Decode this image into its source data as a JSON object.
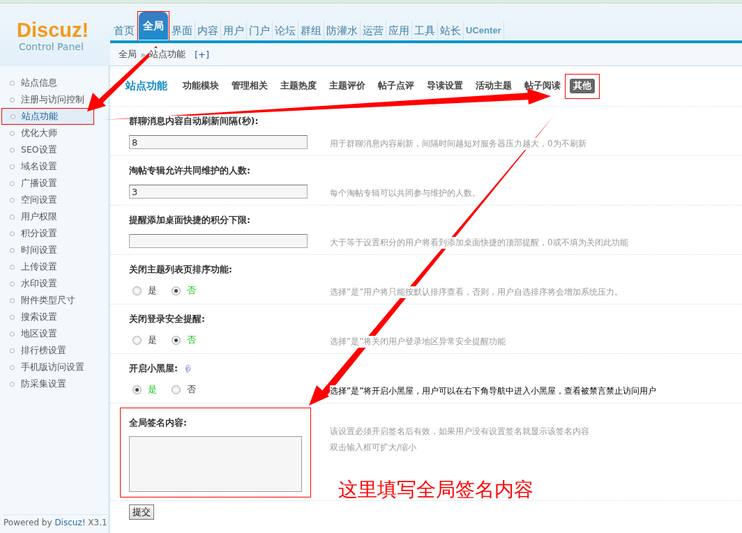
{
  "logo": {
    "name": "Discuz!",
    "subtitle": "Control Panel"
  },
  "nav": [
    {
      "label": "首页",
      "selected": false,
      "annotated": false
    },
    {
      "label": "全局",
      "selected": true,
      "annotated": true
    },
    {
      "label": "界面",
      "selected": false,
      "annotated": false
    },
    {
      "label": "内容",
      "selected": false,
      "annotated": false
    },
    {
      "label": "用户",
      "selected": false,
      "annotated": false
    },
    {
      "label": "门户",
      "selected": false,
      "annotated": false
    },
    {
      "label": "论坛",
      "selected": false,
      "annotated": false
    },
    {
      "label": "群组",
      "selected": false,
      "annotated": false
    },
    {
      "label": "防灌水",
      "selected": false,
      "annotated": false
    },
    {
      "label": "运营",
      "selected": false,
      "annotated": false
    },
    {
      "label": "应用",
      "selected": false,
      "annotated": false
    },
    {
      "label": "工具",
      "selected": false,
      "annotated": false
    },
    {
      "label": "站长",
      "selected": false,
      "annotated": false
    },
    {
      "label": "UCenter",
      "selected": false,
      "annotated": false,
      "kind": "latin"
    }
  ],
  "breadcrumb": {
    "items": [
      "全局",
      "站点功能"
    ],
    "separator": "»",
    "add": "[+]"
  },
  "sidebar": {
    "items": [
      {
        "label": "站点信息",
        "selected": false,
        "annotated": false
      },
      {
        "label": "注册与访问控制",
        "selected": false,
        "annotated": false
      },
      {
        "label": "站点功能",
        "selected": true,
        "annotated": true
      },
      {
        "label": "优化大师",
        "selected": false,
        "annotated": false
      },
      {
        "label": "SEO设置",
        "selected": false,
        "annotated": false
      },
      {
        "label": "域名设置",
        "selected": false,
        "annotated": false
      },
      {
        "label": "广播设置",
        "selected": false,
        "annotated": false
      },
      {
        "label": "空间设置",
        "selected": false,
        "annotated": false
      },
      {
        "label": "用户权限",
        "selected": false,
        "annotated": false
      },
      {
        "label": "积分设置",
        "selected": false,
        "annotated": false
      },
      {
        "label": "时间设置",
        "selected": false,
        "annotated": false
      },
      {
        "label": "上传设置",
        "selected": false,
        "annotated": false
      },
      {
        "label": "水印设置",
        "selected": false,
        "annotated": false
      },
      {
        "label": "附件类型尺寸",
        "selected": false,
        "annotated": false
      },
      {
        "label": "搜索设置",
        "selected": false,
        "annotated": false
      },
      {
        "label": "地区设置",
        "selected": false,
        "annotated": false
      },
      {
        "label": "排行榜设置",
        "selected": false,
        "annotated": false
      },
      {
        "label": "手机版访问设置",
        "selected": false,
        "annotated": false
      },
      {
        "label": "防采集设置",
        "selected": false,
        "annotated": false
      }
    ],
    "footer": {
      "text": "Powered by",
      "link": "Discuz!",
      "version": "X3.1"
    }
  },
  "section_title": "站点功能",
  "subtabs": [
    {
      "label": "功能模块",
      "selected": false,
      "annotated": false
    },
    {
      "label": "管理相关",
      "selected": false,
      "annotated": false
    },
    {
      "label": "主题热度",
      "selected": false,
      "annotated": false
    },
    {
      "label": "主题评价",
      "selected": false,
      "annotated": false
    },
    {
      "label": "帖子点评",
      "selected": false,
      "annotated": false
    },
    {
      "label": "导读设置",
      "selected": false,
      "annotated": false
    },
    {
      "label": "活动主题",
      "selected": false,
      "annotated": false
    },
    {
      "label": "帖子阅读",
      "selected": false,
      "annotated": false
    },
    {
      "label": "其他",
      "selected": true,
      "annotated": true
    }
  ],
  "settings": [
    {
      "kind": "text",
      "label": "群聊消息内容自动刷新间隔(秒):",
      "value": "8",
      "description": "用于群聊消息内容刷新，间隔时间越短对服务器压力越大，0为不刷新",
      "emphasized": false
    },
    {
      "kind": "text",
      "label": "淘帖专辑允许共同维护的人数:",
      "value": "3",
      "description": "每个淘帖专辑可以共同参与维护的人数。",
      "emphasized": false
    },
    {
      "kind": "text",
      "label": "提醒添加桌面快捷的积分下限:",
      "description": "大于等于设置积分的用户将看到添加桌面快捷的顶部提醒，0或不填为关闭此功能",
      "emphasized": false
    },
    {
      "kind": "radio",
      "label": "关闭主题列表页排序功能:",
      "options": [
        {
          "label": "是",
          "selected": false
        },
        {
          "label": "否",
          "selected": true
        }
      ],
      "description": "选择”是”用户将只能按默认排序查看，否则，用户自选排序将会增加系统压力。",
      "emphasized": false
    },
    {
      "kind": "radio",
      "label": "关闭登录安全提醒:",
      "options": [
        {
          "label": "是",
          "selected": false
        },
        {
          "label": "否",
          "selected": true
        }
      ],
      "description": "选择”是”将关闭用户登录地区异常安全提醒功能",
      "emphasized": false
    },
    {
      "kind": "radio",
      "label": "开启小黑屋:",
      "help": true,
      "options": [
        {
          "label": "是",
          "selected": true
        },
        {
          "label": "否",
          "selected": false
        }
      ],
      "description": "选择”是”将开启小黑屋，用户可以在右下角导航中进入小黑屋，查看被禁言禁止访问用户",
      "emphasized": true
    },
    {
      "kind": "textarea",
      "label": "全局签名内容:",
      "description": "该设置必须开启签名后有效，如果用户没有设置签名就显示该签名内容",
      "description_2": "双击输入框可扩大/缩小",
      "emphasized": false,
      "annotated": true
    }
  ],
  "submit": "提交",
  "annotation": "这里填写全局签名内容"
}
